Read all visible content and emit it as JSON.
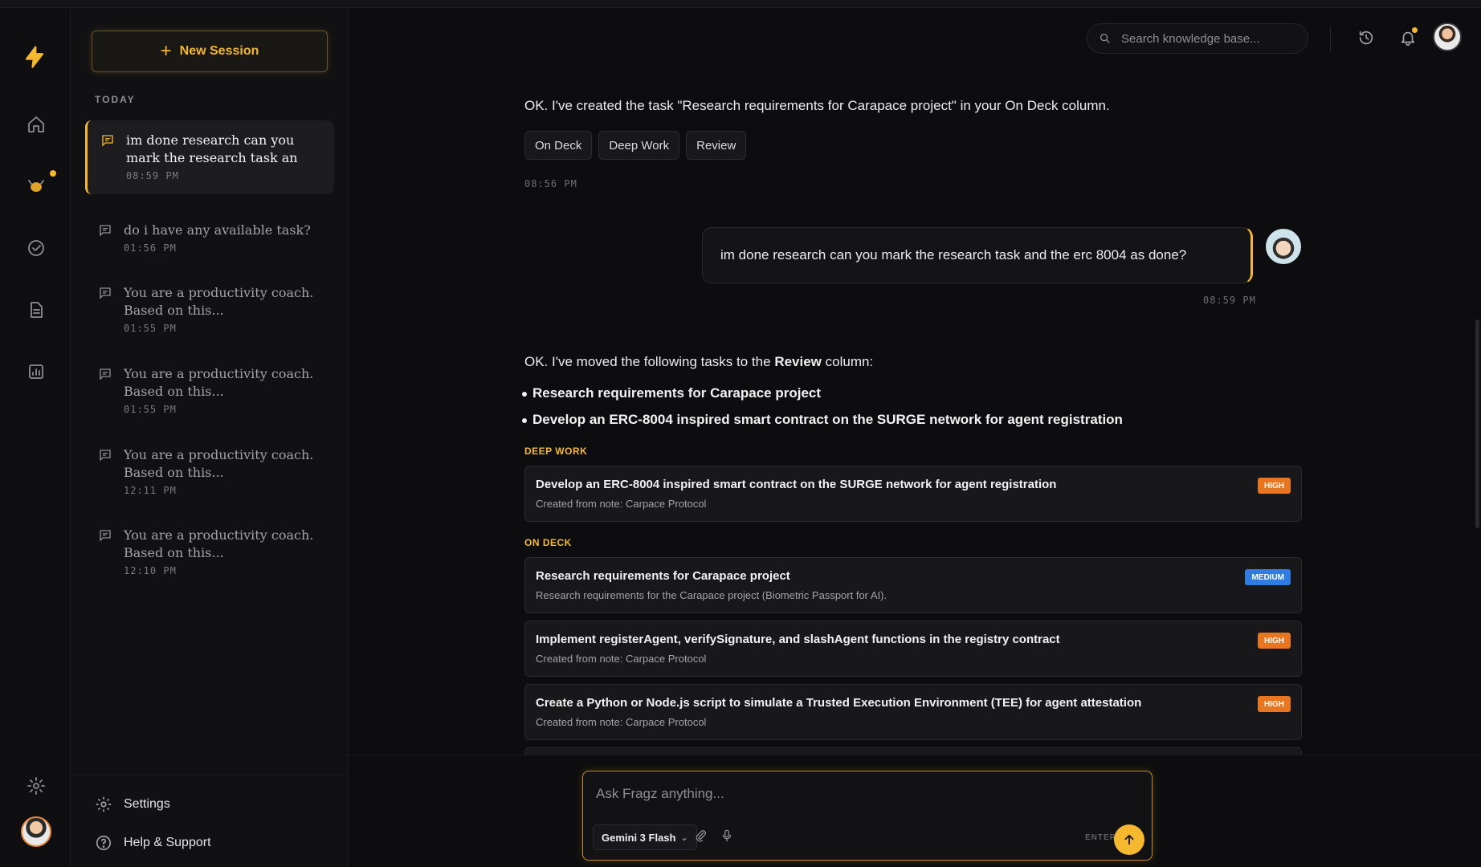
{
  "colors": {
    "accent": "#f5b82e",
    "high": "#e8751f",
    "medium": "#2f7de0"
  },
  "rail": {
    "icons": [
      "bolt-logo-icon",
      "home-icon",
      "agent-bee-icon",
      "check-circle-icon",
      "document-icon",
      "analytics-icon",
      "gear-icon"
    ]
  },
  "sidebar": {
    "new_session": "New Session",
    "section_label": "TODAY",
    "sessions": [
      {
        "title": "im done research can you mark the research task an",
        "time": "08:59 PM"
      },
      {
        "title": "do i have any available task?",
        "time": "01:56 PM"
      },
      {
        "title": "You are a productivity coach. Based on this...",
        "time": "01:55 PM"
      },
      {
        "title": "You are a productivity coach. Based on this...",
        "time": "01:55 PM"
      },
      {
        "title": "You are a productivity coach. Based on this...",
        "time": "12:11 PM"
      },
      {
        "title": "You are a productivity coach. Based on this...",
        "time": "12:10 PM"
      }
    ],
    "settings": "Settings",
    "help": "Help & Support"
  },
  "header": {
    "search_placeholder": "Search knowledge base..."
  },
  "chat": {
    "ai_msg_1": "OK. I've created the task \"Research requirements for Carapace project\" in your On Deck column.",
    "chips": [
      "On Deck",
      "Deep Work",
      "Review"
    ],
    "ai_msg_1_time": "08:56 PM",
    "user_msg": "im done research can you mark the research task and the erc 8004 as done?",
    "user_msg_time": "08:59 PM",
    "ai_msg_2_prefix": "OK. I've moved the following tasks to the",
    "ai_msg_2_bold": "Review",
    "ai_msg_2_suffix": "column:",
    "moved_tasks": [
      "Research requirements for Carapace project",
      "Develop an ERC-8004 inspired smart contract on the SURGE network for agent registration"
    ],
    "deep_work_label": "DEEP WORK",
    "deep_work_cards": [
      {
        "title": "Develop an ERC-8004 inspired smart contract on the SURGE network for agent registration",
        "sub": "Created from note: Carpace Protocol",
        "priority": "HIGH"
      }
    ],
    "on_deck_label": "ON DECK",
    "on_deck_cards": [
      {
        "title": "Research requirements for Carapace project",
        "sub": "Research requirements for the Carapace project (Biometric Passport for AI).",
        "priority": "MEDIUM"
      },
      {
        "title": "Implement registerAgent, verifySignature, and slashAgent functions in the registry contract",
        "sub": "Created from note: Carpace Protocol",
        "priority": "HIGH"
      },
      {
        "title": "Create a Python or Node.js script to simulate a Trusted Execution Environment (TEE) for agent attestation",
        "sub": "Created from note: Carpace Protocol",
        "priority": "HIGH"
      }
    ]
  },
  "composer": {
    "placeholder": "Ask Fragz anything...",
    "model": "Gemini 3 Flash",
    "enter_hint": "ENTER"
  }
}
